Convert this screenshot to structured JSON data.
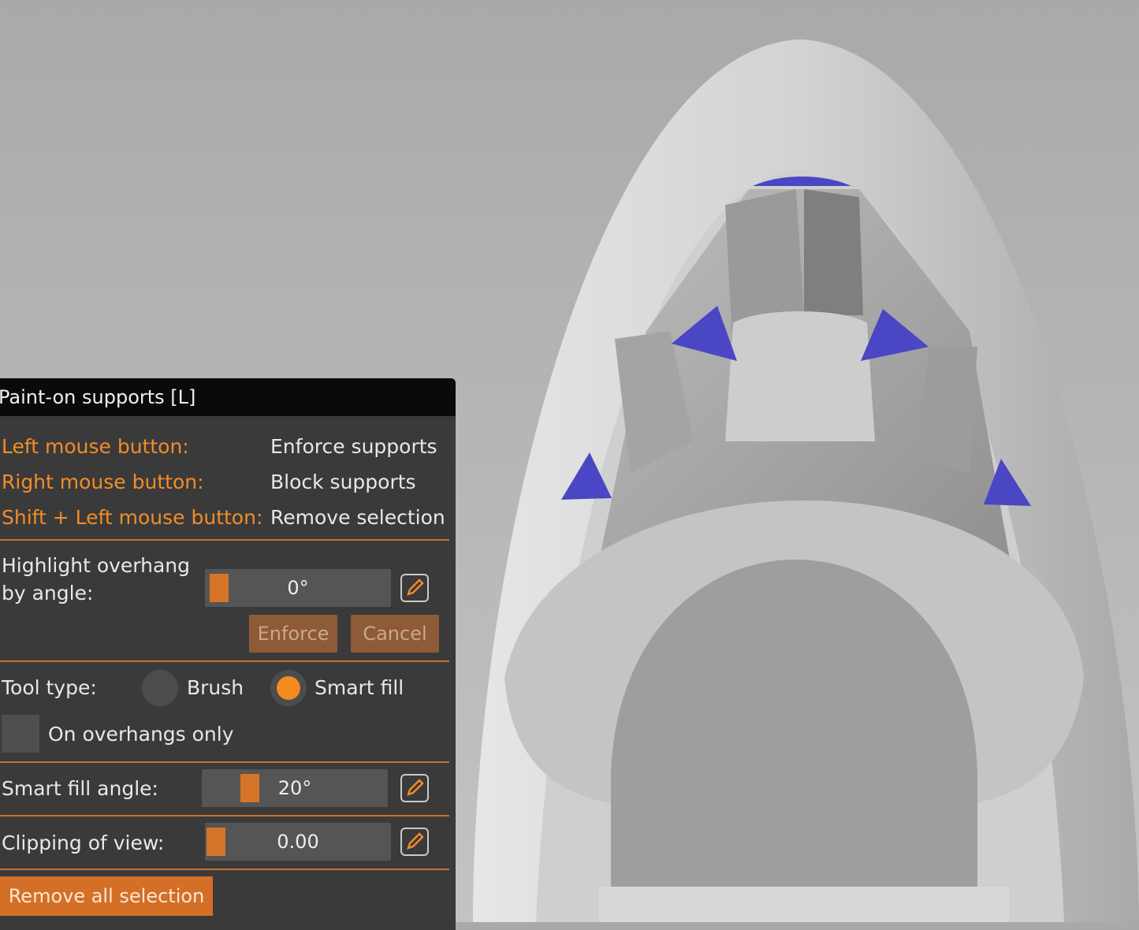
{
  "panel": {
    "title": "Paint-on supports [L]",
    "mouse_help": [
      {
        "key": "Left mouse button:",
        "action": "Enforce supports"
      },
      {
        "key": "Right mouse button:",
        "action": "Block supports"
      },
      {
        "key": "Shift + Left mouse button:",
        "action": "Remove selection"
      }
    ],
    "overhang": {
      "label_line1": "Highlight overhang",
      "label_line2": "by angle:",
      "value": "0°",
      "slider_fraction": 0.0,
      "enforce_label": "Enforce",
      "cancel_label": "Cancel"
    },
    "tool_type": {
      "label": "Tool type:",
      "options": [
        "Brush",
        "Smart fill"
      ],
      "selected": "Smart fill"
    },
    "overhangs_only": {
      "label": "On overhangs only",
      "checked": false
    },
    "smart_fill": {
      "label": "Smart fill angle:",
      "value": "20°",
      "slider_fraction": 0.22
    },
    "clipping": {
      "label": "Clipping of view:",
      "value": "0.00",
      "slider_fraction": 0.0
    },
    "remove_all_label": "Remove all selection"
  },
  "colors": {
    "accent": "#f28c28",
    "panel_bg": "#3a3a3a",
    "support_enforcer": "#4b46c4",
    "model_gray": "#c8c8c8"
  },
  "icons": {
    "edit": "pencil-icon"
  }
}
